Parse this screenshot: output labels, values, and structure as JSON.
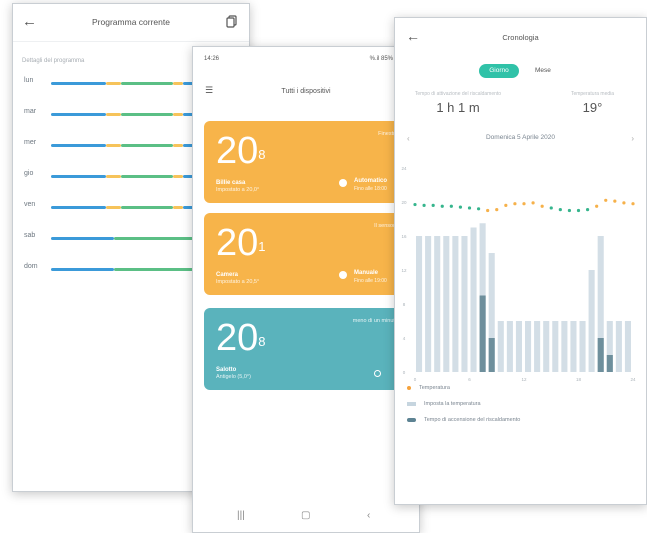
{
  "schedule_screen": {
    "title": "Programma corrente",
    "subtitle": "Dettagli del programma",
    "days": [
      {
        "label": "lun"
      },
      {
        "label": "mar"
      },
      {
        "label": "mer"
      },
      {
        "label": "gio"
      },
      {
        "label": "ven"
      },
      {
        "label": "sab"
      },
      {
        "label": "dom"
      }
    ],
    "colors": {
      "blue": "#3b9ad9",
      "orange": "#f6c35a",
      "green": "#5bbf85"
    }
  },
  "devices_screen": {
    "status_time": "14:26",
    "status_right": "%.il 85%",
    "title": "Tutti i dispositivi",
    "devices": [
      {
        "temp_int": "20",
        "temp_dec": "8",
        "name": "Billie casa",
        "subtitle": "Impostato a 20,0°",
        "note": "Finestra",
        "mode": "Automatico",
        "mode_sub": "Fino alle 18:00",
        "color": "#f7b44a"
      },
      {
        "temp_int": "20",
        "temp_dec": "1",
        "name": "Camera",
        "subtitle": "Impostato a 20,5°",
        "note": "Il sensore",
        "mode": "Manuale",
        "mode_sub": "Fino alle 19:00",
        "color": "#f7b44a"
      },
      {
        "temp_int": "20",
        "temp_dec": "8",
        "name": "Salotto",
        "subtitle": "Antigelo (5,0°)",
        "note": "meno di un minuto",
        "mode": "",
        "mode_sub": "",
        "color": "#5ab3bc"
      }
    ]
  },
  "history_screen": {
    "title": "Cronologia",
    "tab_active": "Giorno",
    "tab_other": "Mese",
    "stat_left_label": "Tempo di attivazione del riscaldamento",
    "stat_left_value": "1 h 1 m",
    "stat_right_label": "Temperatura media",
    "stat_right_value": "19°",
    "date": "Domenica 5 Aprile 2020",
    "legend": [
      {
        "label": "Temperatura",
        "color": "#f6a23c"
      },
      {
        "label": "Imposta la temperatura",
        "color": "#c6d5df"
      },
      {
        "label": "Tempo di accensione del riscaldamento",
        "color": "#5d8393"
      }
    ]
  },
  "chart_data": {
    "type": "bar",
    "x_ticks": [
      "0",
      "6",
      "12",
      "18",
      "24"
    ],
    "y_ticks": [
      "0",
      "4",
      "8",
      "12",
      "16",
      "20",
      "24"
    ],
    "ylim": [
      0,
      24
    ],
    "setpoint": [
      16,
      16,
      16,
      16,
      16,
      16,
      17,
      17.5,
      14,
      6,
      6,
      6,
      6,
      6,
      6,
      6,
      6,
      6,
      6,
      12,
      16,
      6,
      6,
      6
    ],
    "heating_on": [
      0,
      0,
      0,
      0,
      0,
      0,
      0,
      9,
      4,
      0,
      0,
      0,
      0,
      0,
      0,
      0,
      0,
      0,
      0,
      0,
      0,
      0,
      0,
      0
    ],
    "heating_on_b": [
      0,
      0,
      0,
      0,
      0,
      0,
      0,
      0,
      0,
      0,
      0,
      0,
      0,
      0,
      0,
      0,
      0,
      0,
      0,
      0,
      4,
      2,
      0,
      0
    ],
    "temperature": [
      19.7,
      19.6,
      19.6,
      19.5,
      19.5,
      19.4,
      19.3,
      19.2,
      19.0,
      19.1,
      19.6,
      19.8,
      19.8,
      19.9,
      19.5,
      19.3,
      19.1,
      19.0,
      19.0,
      19.1,
      19.5,
      20.2,
      20.1,
      19.9,
      19.8
    ]
  }
}
